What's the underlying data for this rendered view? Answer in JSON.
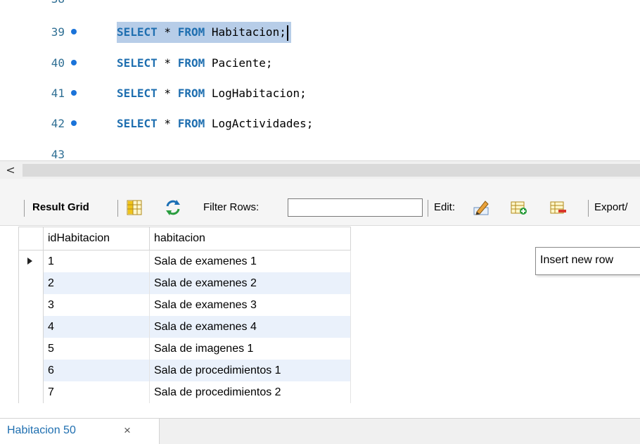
{
  "editor": {
    "partial_top_line": "38",
    "partial_bottom_line": "43",
    "lines": [
      {
        "num": "39",
        "kw1": "SELECT",
        "star": " * ",
        "kw2": "FROM",
        "table": " Habitacion;",
        "selected": true
      },
      {
        "num": "40",
        "kw1": "SELECT",
        "star": " * ",
        "kw2": "FROM",
        "table": " Paciente;"
      },
      {
        "num": "41",
        "kw1": "SELECT",
        "star": " * ",
        "kw2": "FROM",
        "table": " LogHabitacion;"
      },
      {
        "num": "42",
        "kw1": "SELECT",
        "star": " * ",
        "kw2": "FROM",
        "table": " LogActividades;"
      }
    ]
  },
  "scrollbar": {
    "left_arrow": "<"
  },
  "toolbar": {
    "result_grid_label": "Result Grid",
    "filter_label": "Filter Rows:",
    "filter_value": "",
    "edit_label": "Edit:",
    "export_label": "Export/"
  },
  "grid": {
    "columns": [
      "idHabitacion",
      "habitacion"
    ],
    "rows": [
      {
        "id": "1",
        "name": "Sala de examenes 1"
      },
      {
        "id": "2",
        "name": "Sala de examenes 2"
      },
      {
        "id": "3",
        "name": "Sala de examenes 3"
      },
      {
        "id": "4",
        "name": "Sala de examenes 4"
      },
      {
        "id": "5",
        "name": "Sala de imagenes 1"
      },
      {
        "id": "6",
        "name": "Sala de procedimientos 1"
      },
      {
        "id": "7",
        "name": "Sala de procedimientos 2"
      }
    ]
  },
  "tooltip": {
    "text": "Insert new row"
  },
  "tab": {
    "label": "Habitacion 50",
    "close": "×"
  },
  "colors": {
    "keyword": "#1f6fb0",
    "selection": "#b7cde8",
    "alt_row": "#eaf1fb",
    "accent": "#1a73d9"
  }
}
